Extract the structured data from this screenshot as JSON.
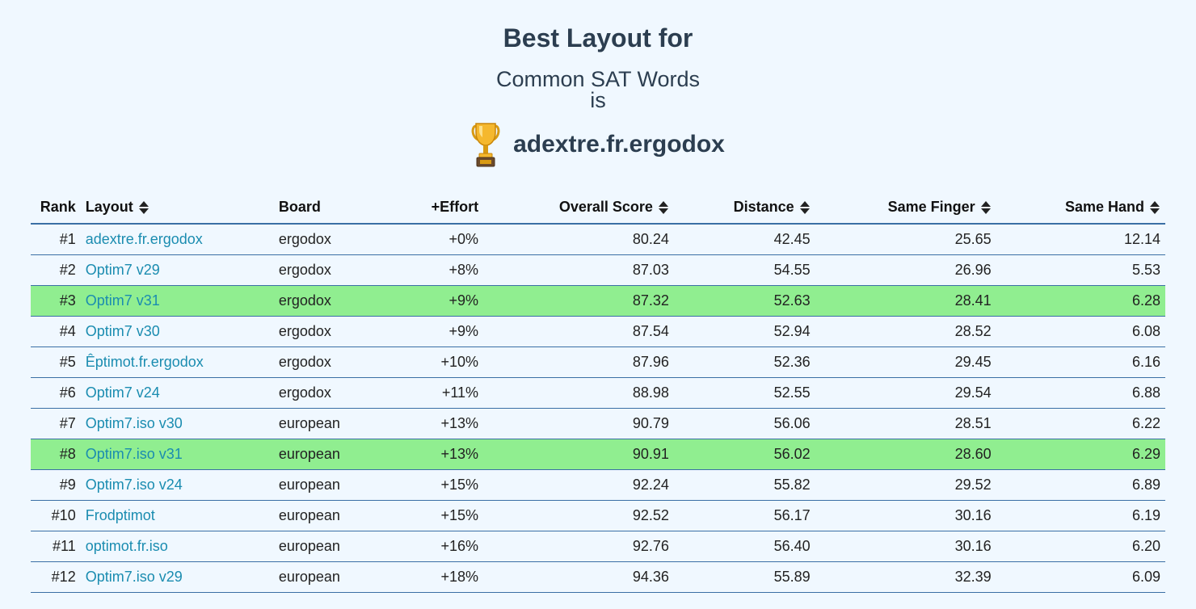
{
  "header": {
    "title": "Best Layout for",
    "subtitle": "Common SAT Words",
    "is_text": "is",
    "winner": "adextre.fr.ergodox"
  },
  "table": {
    "columns": {
      "rank": "Rank",
      "layout": "Layout",
      "board": "Board",
      "effort": "+Effort",
      "overall": "Overall Score",
      "distance": "Distance",
      "same_finger": "Same Finger",
      "same_hand": "Same Hand"
    },
    "rows": [
      {
        "rank": "#1",
        "layout": "adextre.fr.ergodox",
        "board": "ergodox",
        "effort": "+0%",
        "overall": "80.24",
        "distance": "42.45",
        "same_finger": "25.65",
        "same_hand": "12.14",
        "highlighted": false
      },
      {
        "rank": "#2",
        "layout": "Optim7 v29",
        "board": "ergodox",
        "effort": "+8%",
        "overall": "87.03",
        "distance": "54.55",
        "same_finger": "26.96",
        "same_hand": "5.53",
        "highlighted": false
      },
      {
        "rank": "#3",
        "layout": "Optim7 v31",
        "board": "ergodox",
        "effort": "+9%",
        "overall": "87.32",
        "distance": "52.63",
        "same_finger": "28.41",
        "same_hand": "6.28",
        "highlighted": true
      },
      {
        "rank": "#4",
        "layout": "Optim7 v30",
        "board": "ergodox",
        "effort": "+9%",
        "overall": "87.54",
        "distance": "52.94",
        "same_finger": "28.52",
        "same_hand": "6.08",
        "highlighted": false
      },
      {
        "rank": "#5",
        "layout": "Êptimot.fr.ergodox",
        "board": "ergodox",
        "effort": "+10%",
        "overall": "87.96",
        "distance": "52.36",
        "same_finger": "29.45",
        "same_hand": "6.16",
        "highlighted": false
      },
      {
        "rank": "#6",
        "layout": "Optim7 v24",
        "board": "ergodox",
        "effort": "+11%",
        "overall": "88.98",
        "distance": "52.55",
        "same_finger": "29.54",
        "same_hand": "6.88",
        "highlighted": false
      },
      {
        "rank": "#7",
        "layout": "Optim7.iso v30",
        "board": "european",
        "effort": "+13%",
        "overall": "90.79",
        "distance": "56.06",
        "same_finger": "28.51",
        "same_hand": "6.22",
        "highlighted": false
      },
      {
        "rank": "#8",
        "layout": "Optim7.iso v31",
        "board": "european",
        "effort": "+13%",
        "overall": "90.91",
        "distance": "56.02",
        "same_finger": "28.60",
        "same_hand": "6.29",
        "highlighted": true
      },
      {
        "rank": "#9",
        "layout": "Optim7.iso v24",
        "board": "european",
        "effort": "+15%",
        "overall": "92.24",
        "distance": "55.82",
        "same_finger": "29.52",
        "same_hand": "6.89",
        "highlighted": false
      },
      {
        "rank": "#10",
        "layout": "Frodptimot",
        "board": "european",
        "effort": "+15%",
        "overall": "92.52",
        "distance": "56.17",
        "same_finger": "30.16",
        "same_hand": "6.19",
        "highlighted": false
      },
      {
        "rank": "#11",
        "layout": "optimot.fr.iso",
        "board": "european",
        "effort": "+16%",
        "overall": "92.76",
        "distance": "56.40",
        "same_finger": "30.16",
        "same_hand": "6.20",
        "highlighted": false
      },
      {
        "rank": "#12",
        "layout": "Optim7.iso v29",
        "board": "european",
        "effort": "+18%",
        "overall": "94.36",
        "distance": "55.89",
        "same_finger": "32.39",
        "same_hand": "6.09",
        "highlighted": false
      }
    ]
  },
  "colors": {
    "background": "#f0f8ff",
    "highlight": "#90ee90",
    "link": "#1a8cb0",
    "heading": "#2c3e50",
    "row_border": "#3a6fa5"
  },
  "icons": {
    "trophy": "trophy-icon",
    "sort": "sort-icon"
  }
}
